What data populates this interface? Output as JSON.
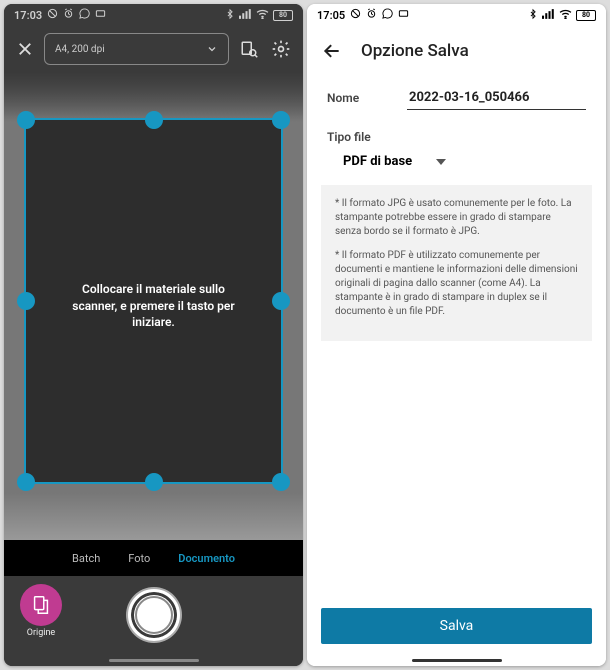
{
  "left": {
    "statusbar": {
      "time": "17:03",
      "battery": "80"
    },
    "header": {
      "preset": "A4, 200 dpi"
    },
    "instruction": "Collocare il materiale sullo scanner, e premere il tasto per iniziare.",
    "tabs": {
      "batch": "Batch",
      "photo": "Foto",
      "document": "Documento"
    },
    "origin_label": "Origine"
  },
  "right": {
    "statusbar": {
      "time": "17:05",
      "battery": "80"
    },
    "title": "Opzione Salva",
    "name_label": "Nome",
    "name_value": "2022-03-16_050466",
    "filetype_label": "Tipo file",
    "filetype_value": "PDF di base",
    "info1": "* Il formato JPG è usato comunemente per le foto. La stampante potrebbe essere in grado di stampare senza bordo se il formato è JPG.",
    "info2": "* Il formato PDF è utilizzato comunemente per documenti e mantiene le informazioni delle dimensioni originali di pagina dallo scanner (come A4). La stampante è in grado di stampare in duplex se il documento è un file PDF.",
    "save_button": "Salva"
  }
}
